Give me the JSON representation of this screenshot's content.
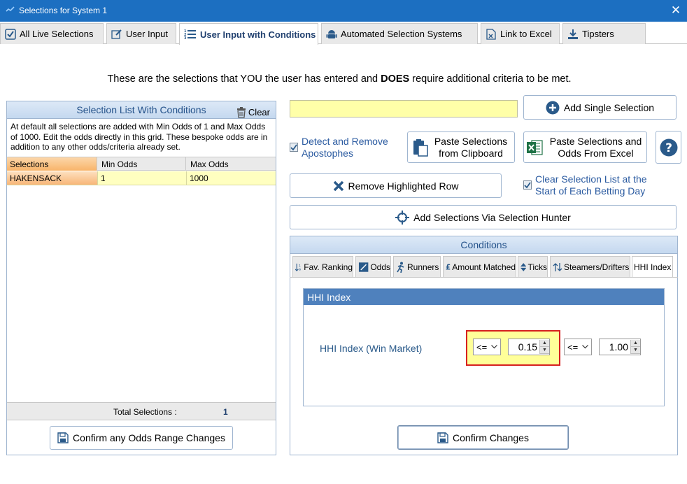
{
  "window": {
    "title": "Selections for System 1"
  },
  "tabs": [
    {
      "label": "All Live Selections",
      "icon": "checkbox-icon"
    },
    {
      "label": "User Input",
      "icon": "edit-icon"
    },
    {
      "label": "User Input with Conditions",
      "icon": "numbered-list-icon",
      "active": true
    },
    {
      "label": "Automated Selection Systems",
      "icon": "android-icon"
    },
    {
      "label": "Link to Excel",
      "icon": "excel-icon"
    },
    {
      "label": "Tipsters",
      "icon": "download-icon"
    }
  ],
  "headline": {
    "part1": "These are the selections that YOU the user has entered and",
    "bold": "DOES",
    "part2": "require additional  criteria to be met."
  },
  "selection_list": {
    "title": "Selection List With Conditions",
    "clear_label": "Clear",
    "note": "At default all selections are added with Min Odds of 1 and Max Odds of 1000. Edit the odds directly in this grid. These bespoke odds are in addition to any other odds/criteria already set.",
    "columns": [
      "Selections",
      "Min Odds",
      "Max Odds"
    ],
    "rows": [
      {
        "selection": "HAKENSACK",
        "min": "1",
        "max": "1000"
      }
    ],
    "total_label": "Total Selections :",
    "total_value": "1",
    "confirm_label": "Confirm any Odds Range Changes"
  },
  "actions": {
    "input_value": "",
    "add_single": "Add Single Selection",
    "detect_apostrophes": "Detect and Remove Apostophes",
    "paste_clipboard": "Paste Selections from Clipboard",
    "paste_excel": "Paste Selections and Odds From Excel",
    "help": "?",
    "remove_row": "Remove Highlighted Row",
    "clear_daily": "Clear Selection List at the Start of Each Betting Day",
    "add_hunter": "Add Selections Via Selection Hunter"
  },
  "conditions": {
    "title": "Conditions",
    "tabs": [
      "Fav. Ranking",
      "Odds",
      "Runners",
      "Amount Matched",
      "Ticks",
      "Steamers/Drifters",
      "HHI Index"
    ],
    "active_tab": "HHI Index",
    "group_title": "HHI Index",
    "field_label": "HHI Index (Win Market)",
    "op1": "<=",
    "val1": "0.15",
    "op2": "<=",
    "val2": "1.00",
    "confirm_label": "Confirm Changes"
  },
  "colors": {
    "titlebar": "#1c6fc1",
    "panel_header": "#c4d8ef",
    "highlight_row": "#ffffc0",
    "selected_cell": "#fbc38a",
    "highlight_box": "#ffff99",
    "highlight_border": "#d62020"
  }
}
